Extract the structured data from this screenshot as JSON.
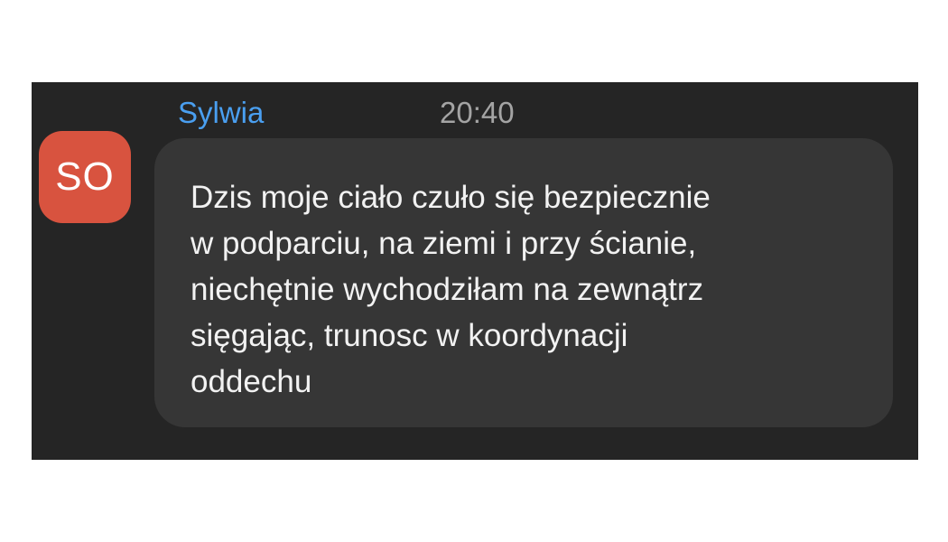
{
  "message": {
    "sender_name": "Sylwia",
    "timestamp": "20:40",
    "avatar_initials": "SO",
    "text": "Dzis moje ciało czuło się bezpiecznie\nw podparciu, na ziemi i przy ścianie,\nniechętnie wychodziłam na zewnątrz\nsięgając, trunosc w koordynacji\noddechu"
  },
  "colors": {
    "panel_background": "#252525",
    "bubble_background": "#363636",
    "sender_name": "#4a9ff0",
    "timestamp": "#a4a4a4",
    "avatar_background": "#d8533f"
  }
}
